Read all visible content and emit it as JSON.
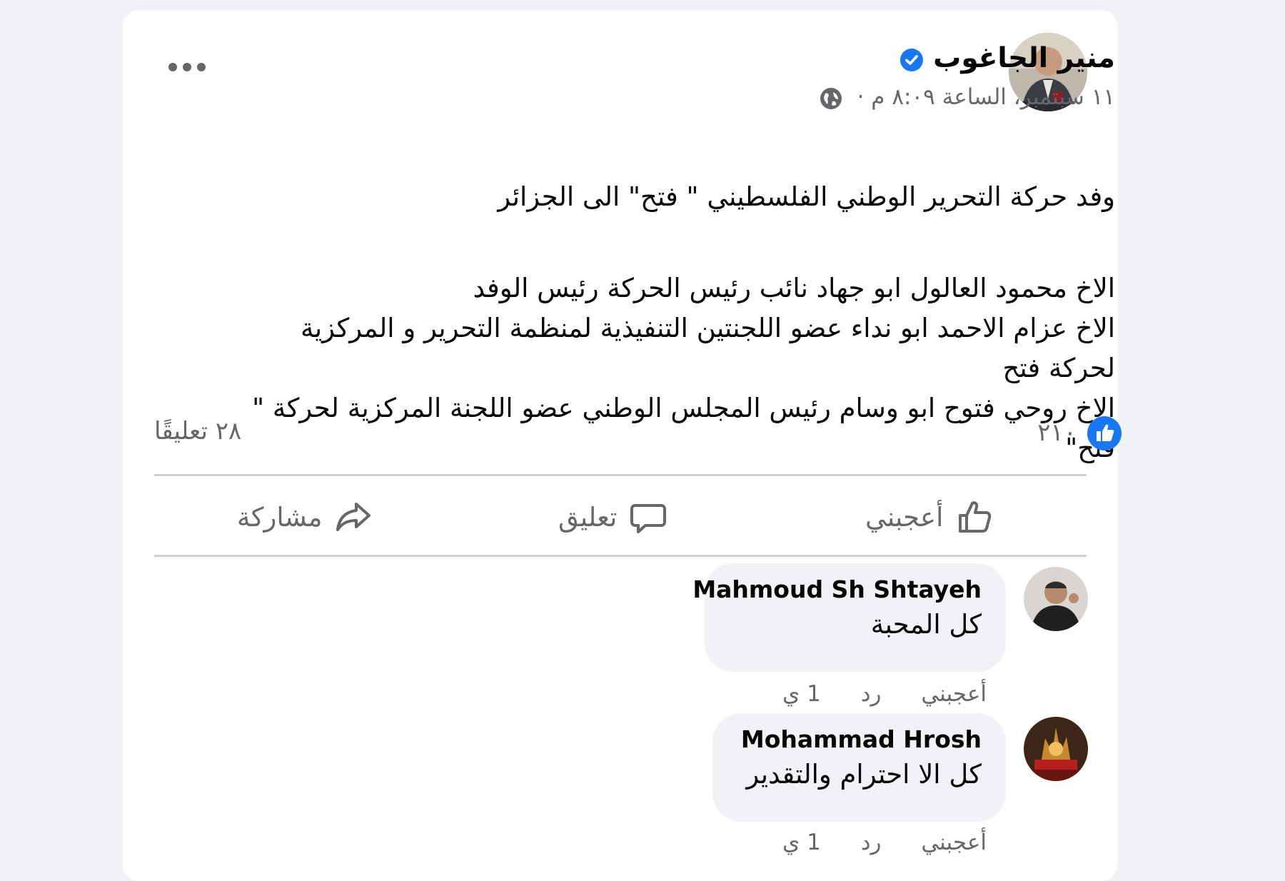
{
  "post": {
    "author": "منير الجاغوب",
    "meta": "١١ سبتمبر، الساعة ٨:٠٩ م ·",
    "text_paragraphs": [
      "وفد حركة التحرير الوطني الفلسطيني \" فتح\" الى الجزائر",
      "الاخ محمود العالول ابو جهاد نائب رئيس الحركة رئيس الوفد\nالاخ عزام الاحمد ابو نداء عضو اللجنتين التنفيذية لمنظمة التحرير و المركزية\nلحركة فتح\nالاخ روحي فتوح ابو وسام رئيس المجلس الوطني عضو اللجنة المركزية لحركة \"\nفتح\""
    ],
    "likes_count": "٢١٠",
    "comments_count": "٢٨ تعليقًا"
  },
  "actions": {
    "like": "أعجبني",
    "comment": "تعليق",
    "share": "مشاركة"
  },
  "comments": [
    {
      "name": "Mahmoud Sh Shtayeh",
      "text": "كل المحبة",
      "like": "أعجبني",
      "reply": "رد",
      "time": "1 ي"
    },
    {
      "name": "Mohammad Hrosh",
      "text": "كل الا احترام والتقدير",
      "like": "أعجبني",
      "reply": "رد",
      "time": "1 ي"
    }
  ],
  "icons": {
    "verified": "verified-badge-icon",
    "globe": "globe-icon",
    "more": "more-dots-icon",
    "like_badge": "like-badge-icon",
    "like": "thumbs-up-icon",
    "comment": "comment-bubble-icon",
    "share": "share-arrow-icon"
  },
  "colors": {
    "accent": "#1877f2",
    "secondary_text": "#65676b",
    "page_bg": "#f0f2f5",
    "card_bg": "#ffffff"
  }
}
